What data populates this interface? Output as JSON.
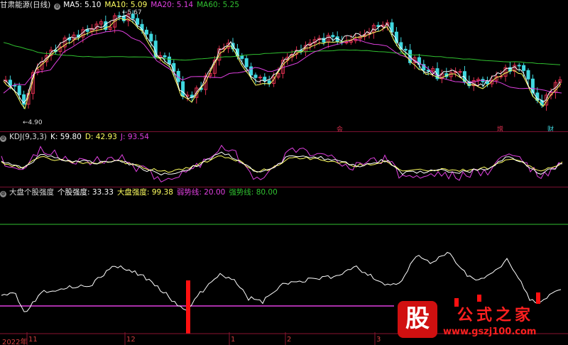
{
  "panel1": {
    "title": "甘肃能源(日线)",
    "ma5": "MA5: 5.10",
    "ma10": "MA10: 5.09",
    "ma20": "MA20: 5.14",
    "ma60": "MA60: 5.25",
    "high_label": "5.67",
    "low_label": "4.90",
    "marker_a": "会",
    "marker_b": "增",
    "marker_c": "财"
  },
  "panel2": {
    "title": "KDJ(9,3,3)",
    "k": "K: 59.80",
    "d": "D: 42.93",
    "j": "J: 93.54"
  },
  "panel3": {
    "title": "大盘个股强度",
    "stock": "个股强度: 33.33",
    "market": "大盘强度: 99.38",
    "weak": "弱势线: 20.00",
    "strong": "强势线: 80.00"
  },
  "xaxis": [
    "2022年",
    "11",
    "12",
    "1",
    "2",
    "3"
  ],
  "watermark": {
    "logo": "股",
    "title": "公式之家",
    "url": "www.gszj100.com"
  },
  "colors": {
    "up": "#e03050",
    "down": "#40d8e0",
    "ma5": "#ffffff",
    "ma10": "#ffff60",
    "ma20": "#e040e0",
    "ma60": "#30c030",
    "k": "#ffffff",
    "d": "#ffff60",
    "j": "#e040e0"
  }
}
